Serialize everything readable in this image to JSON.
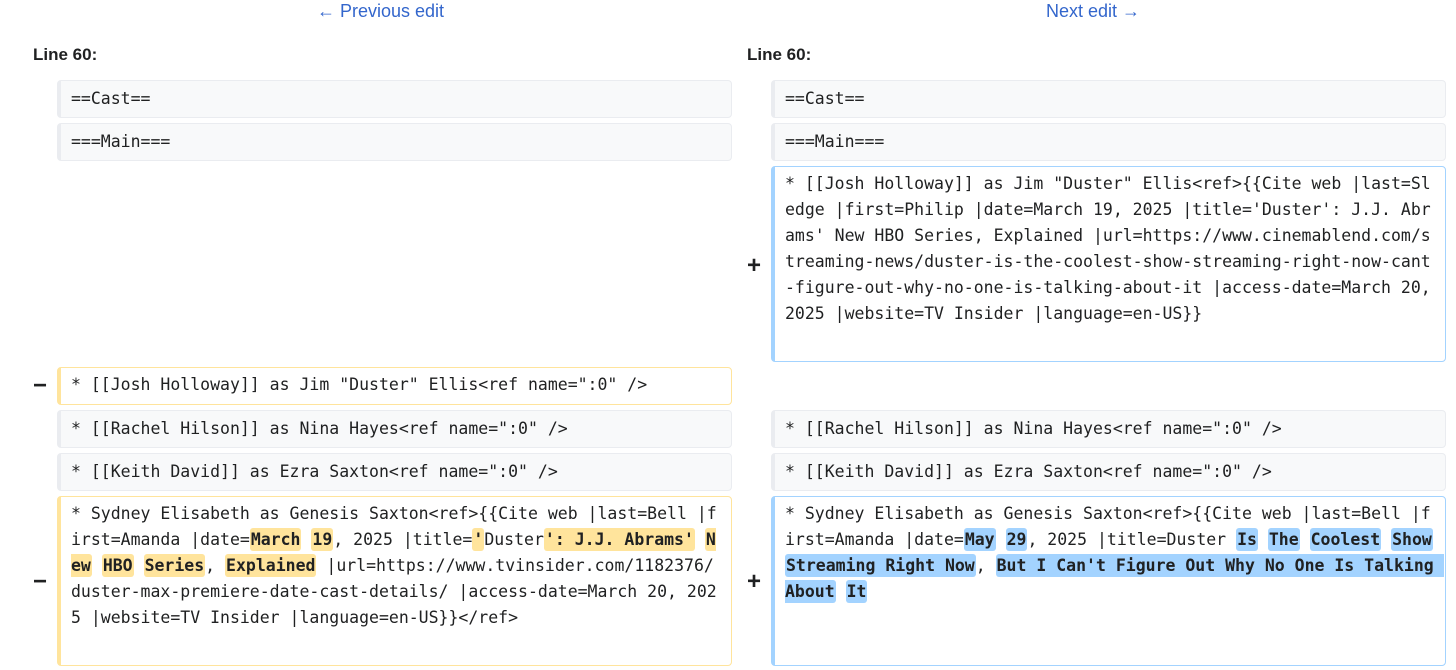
{
  "nav": {
    "previous": "← Previous edit",
    "next": "Next edit →"
  },
  "left": {
    "line_label": "Line 60:",
    "rows": {
      "cast": "==Cast==",
      "main": "===Main===",
      "josh_removed": "* [[Josh Holloway]] as Jim \"Duster\" Ellis<ref name=\":0\" />",
      "rachel": "* [[Rachel Hilson]] as Nina Hayes<ref name=\":0\" />",
      "keith": "* [[Keith David]] as Ezra Saxton<ref name=\":0\" />",
      "sydney": {
        "t1": "* Sydney Elisabeth as Genesis Saxton<ref>{{Cite web |last=Bell |first=Amanda |date=",
        "h1": "March",
        "t2": " ",
        "h2": "19",
        "t3": ", 2025 |title=",
        "h3": "'",
        "t4": "Duster",
        "h4": "': J.J. Abrams'",
        "t5": " ",
        "h5": "New",
        "t6": " ",
        "h6": "HBO",
        "t7": " ",
        "h7": "Series",
        "t8": ", ",
        "h8": "Explained",
        "t9": " |url=https://www.tvinsider.com/1182376/duster-max-premiere-date-cast-details/ |access-date=March 20, 2025 |website=TV Insider |language=en-US}}</ref>"
      }
    },
    "minus": "−"
  },
  "right": {
    "line_label": "Line 60:",
    "rows": {
      "cast": "==Cast==",
      "main": "===Main===",
      "josh_added": "* [[Josh Holloway]] as Jim \"Duster\" Ellis<ref>{{Cite web |last=Sledge |first=Philip |date=March 19, 2025 |title='Duster': J.J. Abrams' New HBO Series, Explained |url=https://www.cinemablend.com/streaming-news/duster-is-the-coolest-show-streaming-right-now-cant-figure-out-why-no-one-is-talking-about-it |access-date=March 20, 2025 |website=TV Insider |language=en-US}}",
      "rachel": "* [[Rachel Hilson]] as Nina Hayes<ref name=\":0\" />",
      "keith": "* [[Keith David]] as Ezra Saxton<ref name=\":0\" />",
      "sydney": {
        "t1": "* Sydney Elisabeth as Genesis Saxton<ref>{{Cite web |last=Bell |first=Amanda |date=",
        "h1": "May",
        "t2": " ",
        "h2": "29",
        "t3": ", 2025 |title=Duster ",
        "h3": "Is",
        "t4": " ",
        "h4": "The",
        "t5": " ",
        "h5": "Coolest",
        "t6": " ",
        "h6": "Show",
        "t7": " ",
        "h7": "Streaming Right Now",
        "t8": ", ",
        "h8": "But I Can't Figure Out Why No One Is Talking About",
        "t9": " ",
        "h9": "It"
      }
    },
    "plus": "+"
  }
}
